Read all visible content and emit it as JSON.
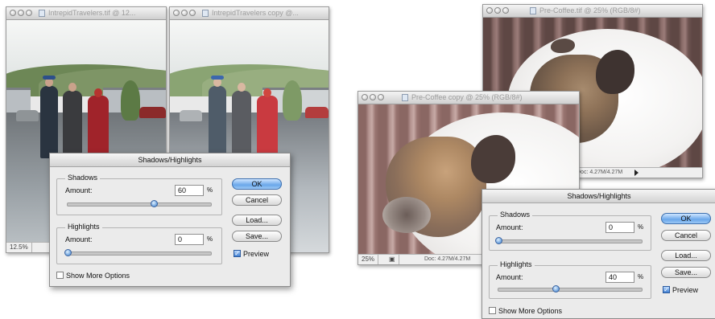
{
  "left": {
    "window1": {
      "title": "IntrepidTravelers.tif @ 12...",
      "zoom": "12.5%"
    },
    "window2": {
      "title": "IntrepidTravelers copy @..."
    },
    "dialog": {
      "title": "Shadows/Highlights",
      "shadows": {
        "label": "Shadows",
        "amount_label": "Amount:",
        "value": "60",
        "unit": "%",
        "level": 0.6
      },
      "highlights": {
        "label": "Highlights",
        "amount_label": "Amount:",
        "value": "0",
        "unit": "%",
        "level": 0
      },
      "buttons": {
        "ok": "OK",
        "cancel": "Cancel",
        "load": "Load...",
        "save": "Save..."
      },
      "preview": {
        "label": "Preview",
        "checked": true
      },
      "more_options": {
        "label": "Show More Options",
        "checked": false
      }
    }
  },
  "right": {
    "window1": {
      "title": "Pre-Coffee.tif @ 25% (RGB/8#)",
      "docsize": "Doc: 4.27M/4.27M"
    },
    "window2": {
      "title": "Pre-Coffee copy @ 25% (RGB/8#)",
      "zoom": "25%",
      "docsize": "Doc: 4.27M/4.27M"
    },
    "dialog": {
      "title": "Shadows/Highlights",
      "shadows": {
        "label": "Shadows",
        "amount_label": "Amount:",
        "value": "0",
        "unit": "%",
        "level": 0
      },
      "highlights": {
        "label": "Highlights",
        "amount_label": "Amount:",
        "value": "40",
        "unit": "%",
        "level": 0.4
      },
      "buttons": {
        "ok": "OK",
        "cancel": "Cancel",
        "load": "Load...",
        "save": "Save..."
      },
      "preview": {
        "label": "Preview",
        "checked": true
      },
      "more_options": {
        "label": "Show More Options",
        "checked": false
      }
    }
  }
}
